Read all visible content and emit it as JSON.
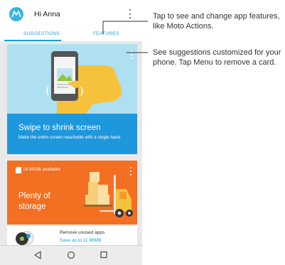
{
  "header": {
    "greeting": "Hi Anna"
  },
  "tabs": [
    {
      "label": "SUGGESTIONS"
    },
    {
      "label": "FEATURES"
    }
  ],
  "card_swipe": {
    "title": "Swipe to shrink screen",
    "description": "Make the entire screen reachable with a single hand"
  },
  "card_storage": {
    "available": "18.80GB available",
    "title": "Plenty of storage"
  },
  "card_apps": {
    "title": "Remove unused apps",
    "subtitle": "Save up to 11.96MB"
  },
  "callouts": {
    "features": "Tap to see and change app features, like Moto Actions.",
    "suggestions": "See suggestions customized for your phone. Tap Menu to remove a card."
  },
  "colors": {
    "accent": "#1d9bd6",
    "card_blue": "#1e97dd",
    "card_orange": "#f36f21",
    "card_sky": "#aee0f1"
  }
}
